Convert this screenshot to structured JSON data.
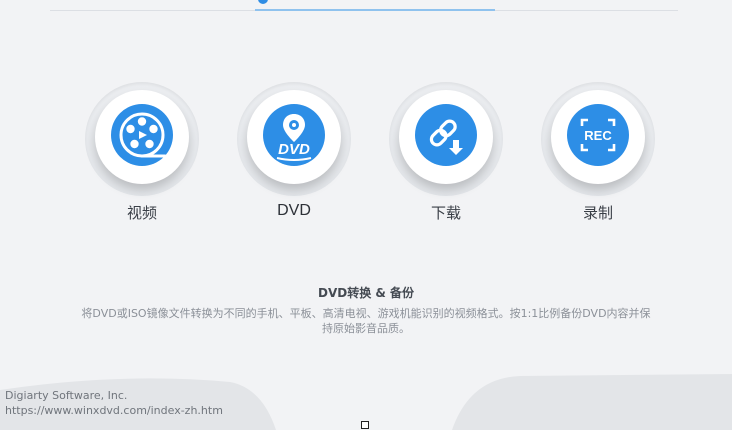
{
  "features": [
    {
      "label": "视频",
      "icon": "film-reel-play-icon"
    },
    {
      "label": "DVD",
      "icon": "dvd-disc-icon",
      "icon_text": "DVD"
    },
    {
      "label": "下载",
      "icon": "link-download-icon"
    },
    {
      "label": "录制",
      "icon": "rec-screen-icon",
      "icon_text": "REC"
    }
  ],
  "description": {
    "title": "DVD转换 & 备份",
    "text": "将DVD或ISO镜像文件转换为不同的手机、平板、高清电视、游戏机能识别的视频格式。按1:1比例备份DVD内容并保持原始影音品质。"
  },
  "footer": {
    "company": "Digiarty Software, Inc.",
    "url": "https://www.winxdvd.com/index-zh.htm"
  },
  "colors": {
    "accent": "#2d8ee6",
    "background": "#f2f3f5",
    "label": "#3a3f47",
    "muted": "#8b9098"
  }
}
